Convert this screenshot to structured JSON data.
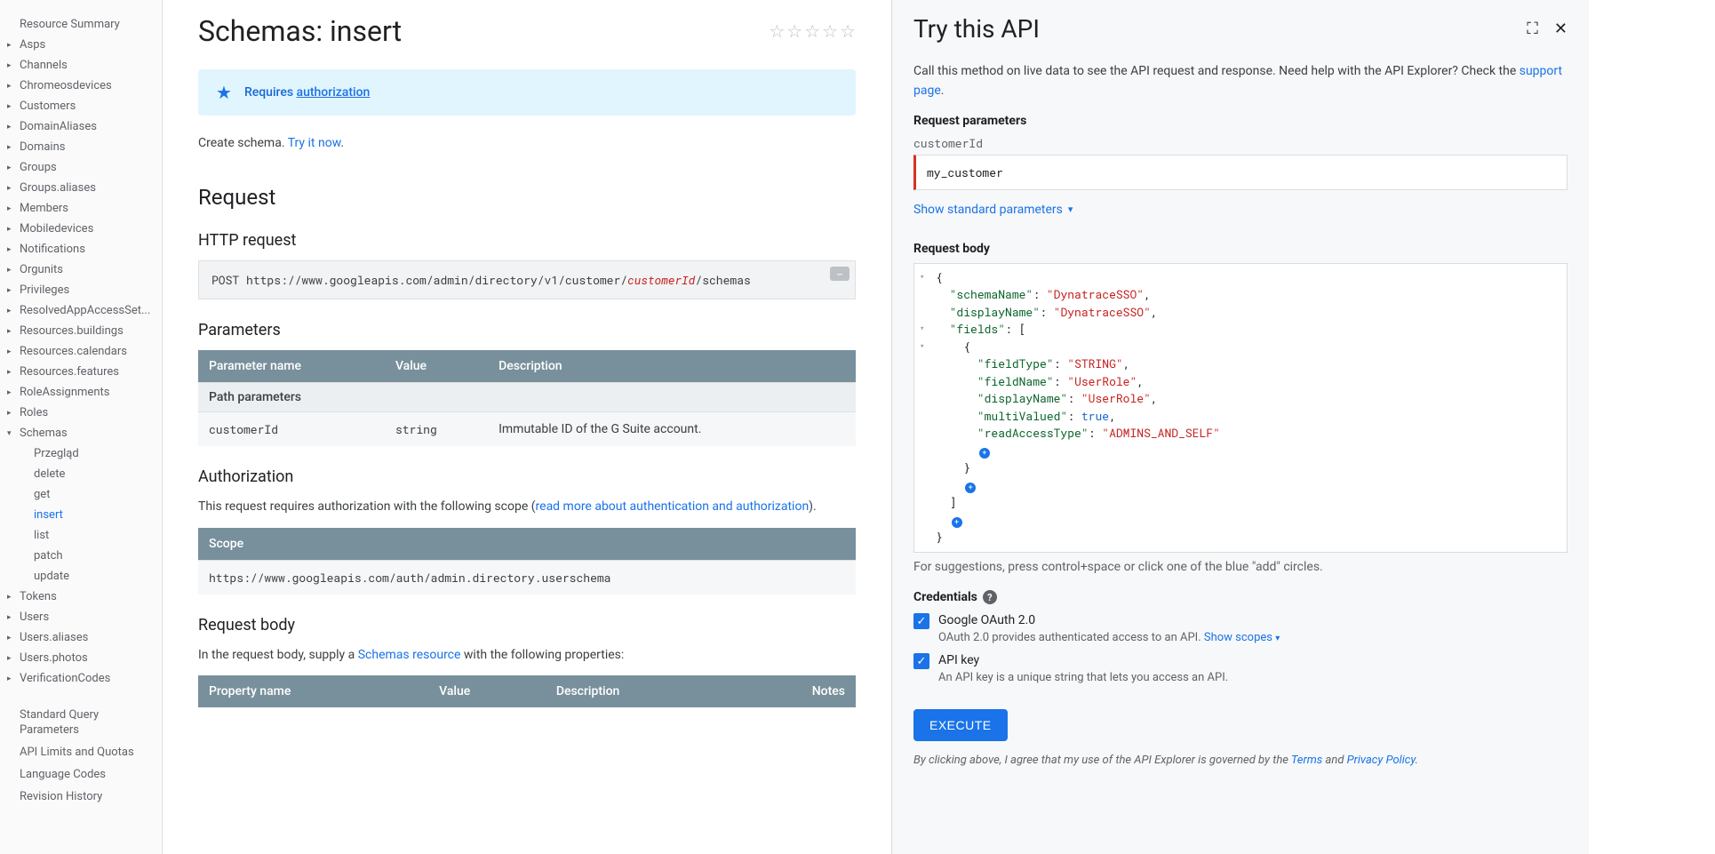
{
  "sidebar": {
    "items": [
      {
        "label": "Resource Summary",
        "caret": false
      },
      {
        "label": "Asps",
        "caret": true
      },
      {
        "label": "Channels",
        "caret": true
      },
      {
        "label": "Chromeosdevices",
        "caret": true
      },
      {
        "label": "Customers",
        "caret": true
      },
      {
        "label": "DomainAliases",
        "caret": true
      },
      {
        "label": "Domains",
        "caret": true
      },
      {
        "label": "Groups",
        "caret": true
      },
      {
        "label": "Groups.aliases",
        "caret": true
      },
      {
        "label": "Members",
        "caret": true
      },
      {
        "label": "Mobiledevices",
        "caret": true
      },
      {
        "label": "Notifications",
        "caret": true
      },
      {
        "label": "Orgunits",
        "caret": true
      },
      {
        "label": "Privileges",
        "caret": true
      },
      {
        "label": "ResolvedAppAccessSet...",
        "caret": true
      },
      {
        "label": "Resources.buildings",
        "caret": true
      },
      {
        "label": "Resources.calendars",
        "caret": true
      },
      {
        "label": "Resources.features",
        "caret": true
      },
      {
        "label": "RoleAssignments",
        "caret": true
      },
      {
        "label": "Roles",
        "caret": true
      }
    ],
    "schemas_label": "Schemas",
    "schemas_children": [
      {
        "label": "Przegląd",
        "active": false
      },
      {
        "label": "delete",
        "active": false
      },
      {
        "label": "get",
        "active": false
      },
      {
        "label": "insert",
        "active": true
      },
      {
        "label": "list",
        "active": false
      },
      {
        "label": "patch",
        "active": false
      },
      {
        "label": "update",
        "active": false
      }
    ],
    "items_after": [
      {
        "label": "Tokens",
        "caret": true
      },
      {
        "label": "Users",
        "caret": true
      },
      {
        "label": "Users.aliases",
        "caret": true
      },
      {
        "label": "Users.photos",
        "caret": true
      },
      {
        "label": "VerificationCodes",
        "caret": true
      }
    ],
    "footer_items": [
      "Standard Query Parameters",
      "API Limits and Quotas",
      "Language Codes",
      "Revision History"
    ]
  },
  "page": {
    "title": "Schemas: insert",
    "requires_text": "Requires ",
    "requires_link": "authorization",
    "intro_text": "Create schema. ",
    "try_link": "Try it now",
    "request_heading": "Request",
    "http_heading": "HTTP request",
    "http_method": "POST ",
    "http_url_prefix": "https://www.googleapis.com/admin/directory/v1/customer/",
    "http_param": "customerId",
    "http_url_suffix": "/schemas",
    "params_heading": "Parameters",
    "table_headers": [
      "Parameter name",
      "Value",
      "Description"
    ],
    "path_params_label": "Path parameters",
    "params": [
      {
        "name": "customerId",
        "type": "string",
        "desc": "Immutable ID of the G Suite account."
      }
    ],
    "auth_heading": "Authorization",
    "auth_text_1": "This request requires authorization with the following scope (",
    "auth_link": "read more about authentication and authorization",
    "auth_text_2": ").",
    "scope_header": "Scope",
    "scope_value": "https://www.googleapis.com/auth/admin.directory.userschema",
    "reqbody_heading": "Request body",
    "reqbody_text_1": "In the request body, supply a ",
    "reqbody_link": "Schemas resource",
    "reqbody_text_2": " with the following properties:",
    "props_headers": [
      "Property name",
      "Value",
      "Description",
      "Notes"
    ]
  },
  "try": {
    "title": "Try this API",
    "intro": "Call this method on live data to see the API request and response. Need help with the API Explorer? Check the ",
    "support_link": "support page",
    "req_params_label": "Request parameters",
    "param_name": "customerId",
    "param_value": "my_customer",
    "show_std": "Show standard parameters",
    "req_body_label": "Request body",
    "body": {
      "schemaName": "DynatraceSSO",
      "displayName": "DynatraceSSO",
      "field_fieldType": "STRING",
      "field_fieldName": "UserRole",
      "field_displayName": "UserRole",
      "field_multiValued": "true",
      "field_readAccessType": "ADMINS_AND_SELF"
    },
    "hint": "For suggestions, press control+space or click one of the blue \"add\" circles.",
    "credentials_label": "Credentials",
    "oauth_label": "Google OAuth 2.0",
    "oauth_desc": "OAuth 2.0 provides authenticated access to an API. ",
    "show_scopes": "Show scopes",
    "apikey_label": "API key",
    "apikey_desc": "An API key is a unique string that lets you access an API.",
    "execute": "EXECUTE",
    "legal_1": "By clicking above, I agree that my use of the API Explorer is governed by the ",
    "terms": "Terms",
    "legal_2": " and ",
    "privacy": "Privacy Policy",
    "legal_3": "."
  }
}
